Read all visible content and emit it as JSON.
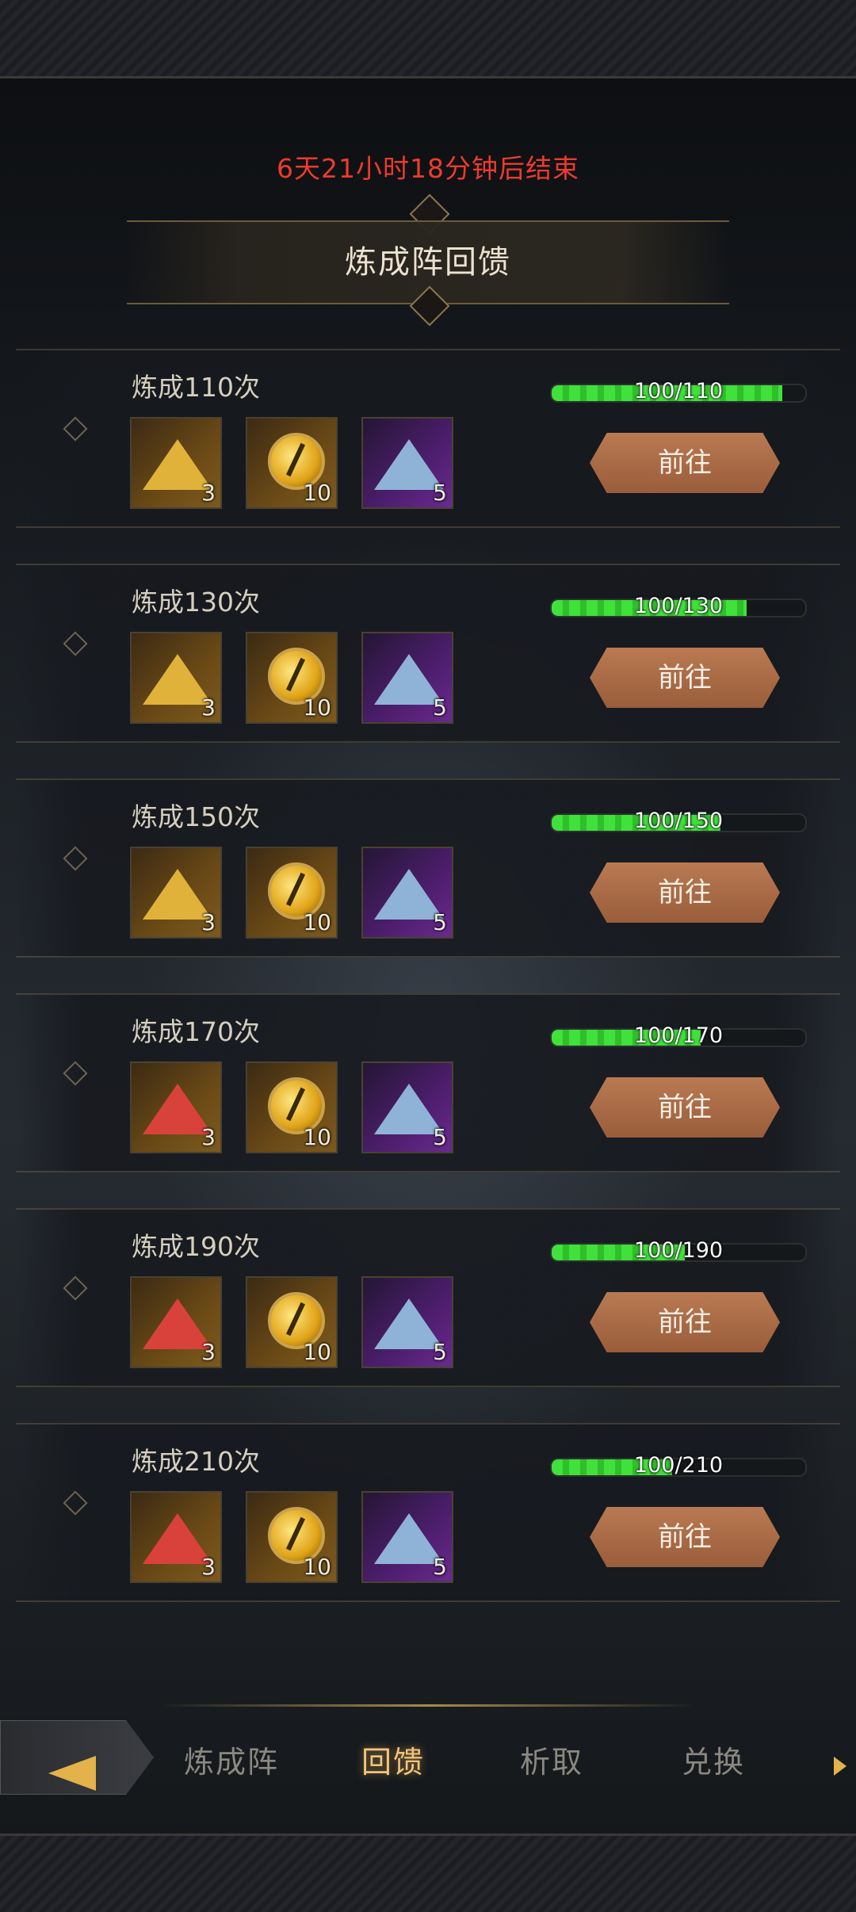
{
  "event": {
    "countdown": "6天21小时18分钟后结束",
    "title": "炼成阵回馈"
  },
  "tasks": [
    {
      "title": "炼成110次",
      "progress_text": "100/110",
      "progress": 0.909,
      "rewards": [
        {
          "icon": "gold-dust-icon",
          "qty": "3"
        },
        {
          "icon": "golden-eye-orb-icon",
          "qty": "10"
        },
        {
          "icon": "blue-crystal-pile-icon",
          "qty": "5"
        }
      ],
      "button": "前往"
    },
    {
      "title": "炼成130次",
      "progress_text": "100/130",
      "progress": 0.769,
      "rewards": [
        {
          "icon": "gold-dust-icon",
          "qty": "3"
        },
        {
          "icon": "golden-eye-orb-icon",
          "qty": "10"
        },
        {
          "icon": "blue-crystal-pile-icon",
          "qty": "5"
        }
      ],
      "button": "前往"
    },
    {
      "title": "炼成150次",
      "progress_text": "100/150",
      "progress": 0.667,
      "rewards": [
        {
          "icon": "gold-dust-icon",
          "qty": "3"
        },
        {
          "icon": "golden-eye-orb-icon",
          "qty": "10"
        },
        {
          "icon": "blue-crystal-pile-icon",
          "qty": "5"
        }
      ],
      "button": "前往"
    },
    {
      "title": "炼成170次",
      "progress_text": "100/170",
      "progress": 0.588,
      "rewards": [
        {
          "icon": "red-dust-icon",
          "qty": "3"
        },
        {
          "icon": "golden-eye-orb-icon",
          "qty": "10"
        },
        {
          "icon": "blue-crystal-pile-icon",
          "qty": "5"
        }
      ],
      "button": "前往"
    },
    {
      "title": "炼成190次",
      "progress_text": "100/190",
      "progress": 0.526,
      "rewards": [
        {
          "icon": "red-dust-icon",
          "qty": "3"
        },
        {
          "icon": "golden-eye-orb-icon",
          "qty": "10"
        },
        {
          "icon": "blue-crystal-pile-icon",
          "qty": "5"
        }
      ],
      "button": "前往"
    },
    {
      "title": "炼成210次",
      "progress_text": "100/210",
      "progress": 0.476,
      "rewards": [
        {
          "icon": "red-dust-icon",
          "qty": "3"
        },
        {
          "icon": "golden-eye-orb-icon",
          "qty": "10"
        },
        {
          "icon": "blue-crystal-pile-icon",
          "qty": "5"
        }
      ],
      "button": "前往"
    }
  ],
  "nav": {
    "back_icon": "back-arrow-icon",
    "tabs": [
      {
        "label": "炼成阵",
        "active": false
      },
      {
        "label": "回馈",
        "active": true
      },
      {
        "label": "析取",
        "active": false
      },
      {
        "label": "兑换",
        "active": false
      }
    ],
    "more_icon": "chevron-right-icon"
  },
  "colors": {
    "countdown": "#ee3b2d",
    "progress_fill": "#3fe13a",
    "button": "#b97a52",
    "active_tab": "#f2c47a"
  }
}
